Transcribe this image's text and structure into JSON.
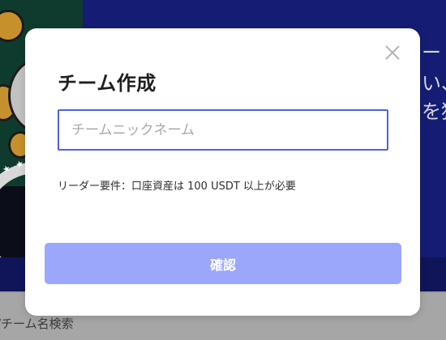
{
  "background": {
    "banner_lines": [
      "ー",
      "い、",
      "を獲"
    ],
    "search_text": "/チーム名検索",
    "banner_color": "#141d73"
  },
  "modal": {
    "title": "チーム作成",
    "input": {
      "value": "",
      "placeholder": "チームニックネーム"
    },
    "requirement": "リーダー要件：口座資産は 100 USDT 以上が必要",
    "confirm_label": "確認",
    "close_icon": "close-icon",
    "colors": {
      "accent": "#4d63dd",
      "button": "#9ba7fb"
    }
  }
}
